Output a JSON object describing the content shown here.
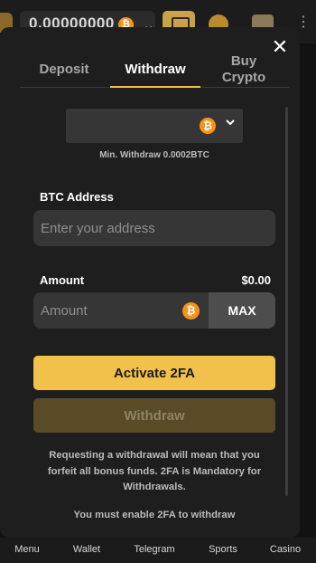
{
  "appbar": {
    "balance": "0.00000000"
  },
  "tabs": {
    "deposit": "Deposit",
    "withdraw": "Withdraw",
    "buy_line1": "Buy",
    "buy_line2": "Crypto"
  },
  "coin": {
    "symbol": "₿",
    "min_withdraw": "Min. Withdraw 0.0002BTC"
  },
  "address": {
    "label": "BTC Address",
    "placeholder": "Enter your address"
  },
  "amount": {
    "label": "Amount",
    "value": "$0.00",
    "placeholder": "Amount",
    "max_label": "MAX"
  },
  "buttons": {
    "activate_2fa": "Activate 2FA",
    "withdraw": "Withdraw"
  },
  "notes": {
    "warning": "Requesting a withdrawal will mean that you forfeit all bonus funds. 2FA is Mandatory for Withdrawals.",
    "enable_2fa": "You must enable 2FA to withdraw"
  },
  "bottom_nav": {
    "menu": "Menu",
    "wallet": "Wallet",
    "telegram": "Telegram",
    "sports": "Sports",
    "casino": "Casino"
  },
  "colors": {
    "accent": "#f1c14c",
    "btc": "#f7931a",
    "modal_bg": "#1e1e1e",
    "input_bg": "#363636"
  },
  "icons": [
    "close-icon",
    "bitcoin-icon",
    "chevron-down-icon"
  ]
}
